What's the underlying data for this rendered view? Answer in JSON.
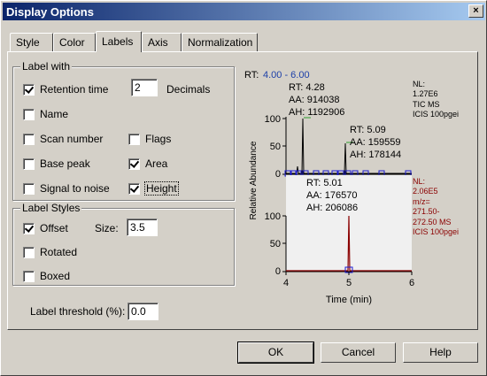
{
  "window": {
    "title": "Display Options",
    "close_glyph": "×"
  },
  "tabs": [
    {
      "label": "Style",
      "active": false
    },
    {
      "label": "Color",
      "active": false
    },
    {
      "label": "Labels",
      "active": true
    },
    {
      "label": "Axis",
      "active": false
    },
    {
      "label": "Normalization",
      "active": false
    }
  ],
  "label_with": {
    "title": "Label with",
    "retention_time": {
      "label": "Retention time",
      "checked": true
    },
    "decimals": {
      "value": "2",
      "label": "Decimals"
    },
    "name": {
      "label": "Name",
      "checked": false
    },
    "scan_number": {
      "label": "Scan number",
      "checked": false
    },
    "flags": {
      "label": "Flags",
      "checked": false
    },
    "base_peak": {
      "label": "Base peak",
      "checked": false
    },
    "area": {
      "label": "Area",
      "checked": true
    },
    "signal_to_noise": {
      "label": "Signal to noise",
      "checked": false
    },
    "height": {
      "label": "Height",
      "checked": true
    }
  },
  "label_styles": {
    "title": "Label Styles",
    "offset": {
      "label": "Offset",
      "checked": true
    },
    "size": {
      "label": "Size:",
      "value": "3.5"
    },
    "rotated": {
      "label": "Rotated",
      "checked": false
    },
    "boxed": {
      "label": "Boxed",
      "checked": false
    }
  },
  "threshold": {
    "label": "Label threshold (%):",
    "value": "0.0"
  },
  "buttons": {
    "ok": "OK",
    "cancel": "Cancel",
    "help": "Help"
  },
  "preview": {
    "rt_range_prefix": "RT:",
    "rt_range": "4.00 - 6.00",
    "y_axis_label": "Relative Abundance",
    "x_axis_label": "Time (min)",
    "x_ticks": [
      "4",
      "5",
      "6"
    ],
    "top": {
      "y_ticks": [
        "100",
        "50",
        "0"
      ],
      "peak1": {
        "rt": "RT: 4.28",
        "aa": "AA: 914038",
        "ah": "AH: 1192906"
      },
      "peak2": {
        "rt": "RT: 5.09",
        "aa": "AA: 159559",
        "ah": "AH: 178144"
      },
      "info": [
        "NL:",
        "1.27E6",
        "TIC  MS",
        "ICIS 100pgei"
      ],
      "info_color": "#000000"
    },
    "bottom": {
      "y_ticks": [
        "100",
        "50",
        "0"
      ],
      "peak": {
        "rt": "RT: 5.01",
        "aa": "AA: 176570",
        "ah": "AH: 206086"
      },
      "info": [
        "NL:",
        "2.06E5",
        "m/z=",
        "271.50-",
        "272.50 MS",
        "ICIS 100pgei"
      ],
      "info_color": "#8b0000"
    },
    "colors": {
      "trace_top": "#000000",
      "trace_bottom": "#8b0000",
      "range": "#1c3fa8",
      "marker": "#1c1cd0",
      "label_line": "#2e9e2e"
    }
  }
}
